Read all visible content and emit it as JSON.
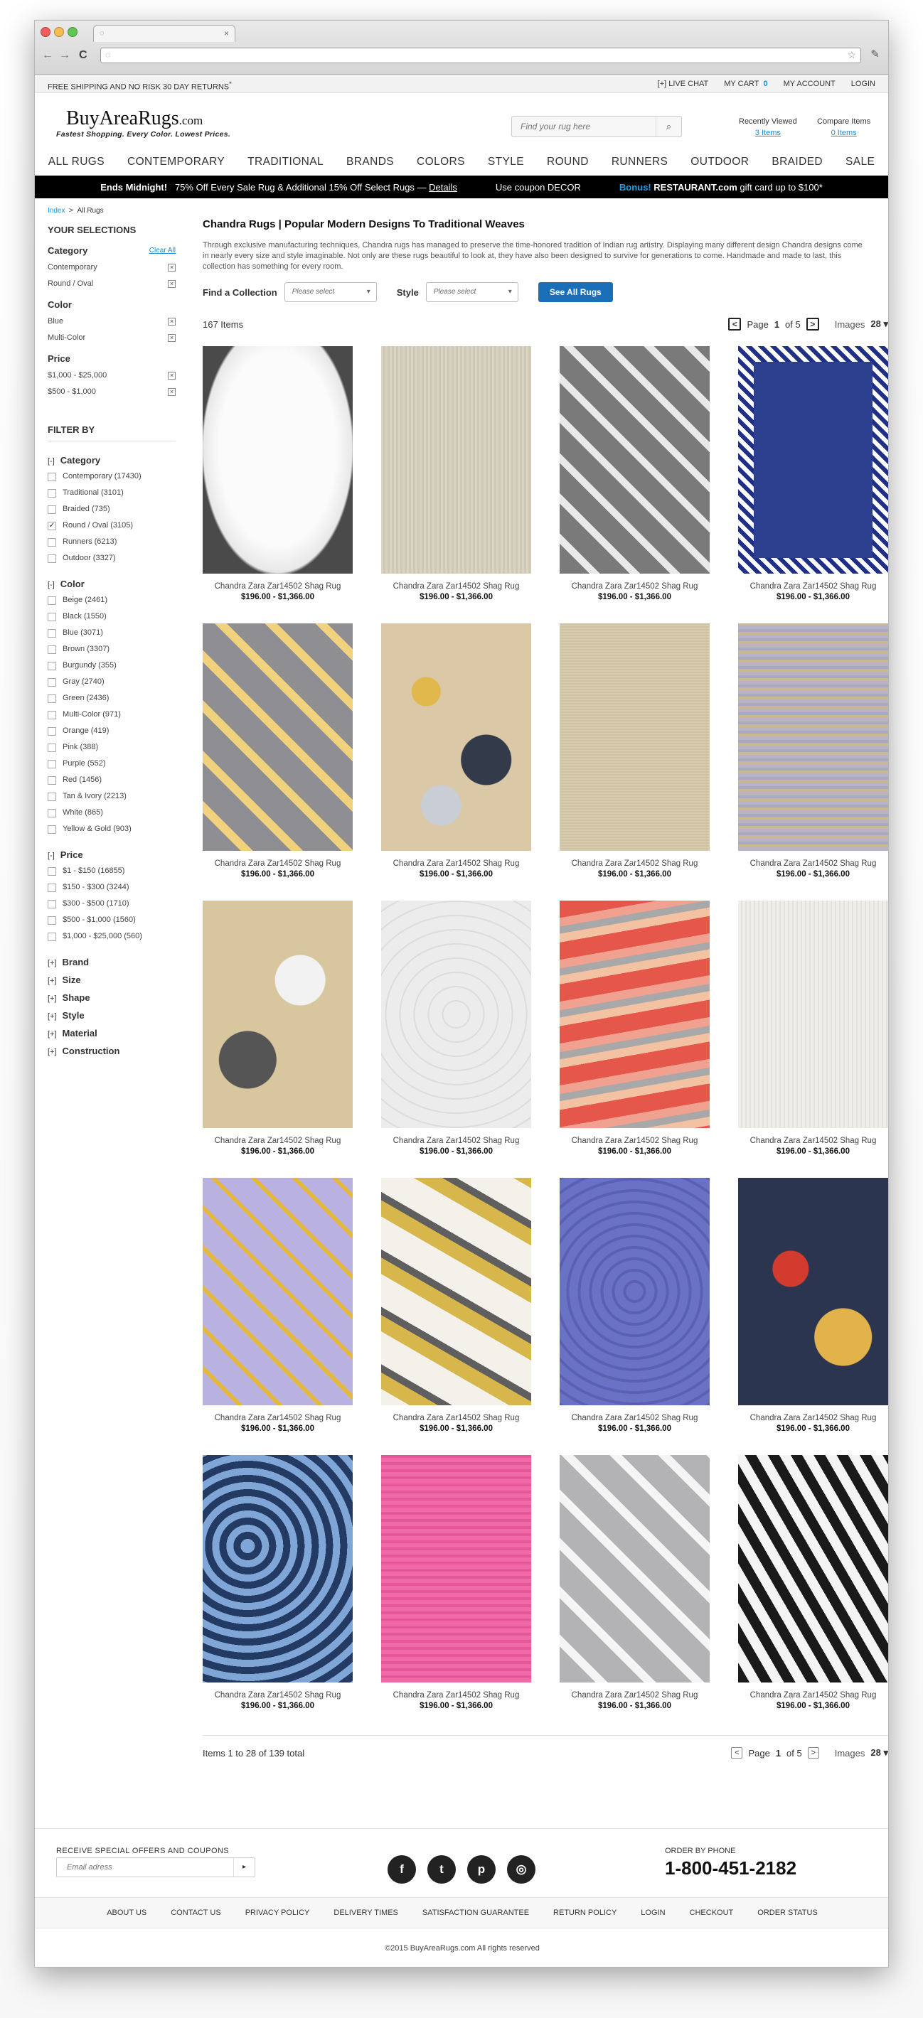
{
  "browser": {
    "colors": {
      "close": "#ee5f5b",
      "min": "#f5bd4f",
      "max": "#61c454"
    },
    "tab_icon": "globe-icon",
    "tab_close": "×",
    "back": "←",
    "forward": "→",
    "reload": "C",
    "url": "",
    "star": "☆",
    "wrench": "🔧"
  },
  "topbar": {
    "shipping": "FREE SHIPPING AND NO RISK 30 DAY RETURNS",
    "shipping_mark": "*",
    "live_chat": "[+] LIVE CHAT",
    "my_cart": "MY CART",
    "cart_count": "0",
    "my_account": "MY ACCOUNT",
    "login": "LOGIN"
  },
  "header": {
    "logo": "BuyAreaRugs",
    "logo_tld": ".com",
    "tagline": "Fastest Shopping. Every Color. Lowest Prices.",
    "search_placeholder": "Find your rug here",
    "search_icon": "search-icon",
    "recently_viewed_label": "Recently Viewed",
    "recently_viewed_count": "3 Items",
    "compare_label": "Compare Items",
    "compare_count": "0 Items"
  },
  "mainnav": [
    "ALL RUGS",
    "CONTEMPORARY",
    "TRADITIONAL",
    "BRANDS",
    "COLORS",
    "STYLE",
    "ROUND",
    "RUNNERS",
    "OUTDOOR",
    "BRAIDED",
    "SALE"
  ],
  "promo": {
    "ends": "Ends Midnight!",
    "offer": "75% Off Every Sale Rug & Additional 15% Off Select Rugs",
    "dash": "—",
    "details": "Details",
    "coupon": "Use coupon DECOR",
    "bonus": "Bonus!",
    "restaurant": "RESTAURANT.com",
    "gift": "gift card up to $100*"
  },
  "breadcrumb": {
    "index": "Index",
    "sep": ">",
    "current": "All Rugs"
  },
  "selections": {
    "title": "YOUR SELECTIONS",
    "clear_all": "Clear All",
    "groups": [
      {
        "name": "Category",
        "items": [
          "Contemporary",
          "Round / Oval"
        ]
      },
      {
        "name": "Color",
        "items": [
          "Blue",
          "Multi-Color"
        ]
      },
      {
        "name": "Price",
        "items": [
          "$1,000 - $25,000",
          "$500 - $1,000"
        ]
      }
    ],
    "remove_glyph": "×"
  },
  "filter": {
    "title": "FILTER BY",
    "groups": [
      {
        "name": "Category",
        "toggle": "[-]",
        "items": [
          {
            "label": "Contemporary (17430)",
            "checked": false
          },
          {
            "label": "Traditional (3101)",
            "checked": false
          },
          {
            "label": "Braided (735)",
            "checked": false
          },
          {
            "label": "Round / Oval (3105)",
            "checked": true
          },
          {
            "label": "Runners (6213)",
            "checked": false
          },
          {
            "label": "Outdoor (3327)",
            "checked": false
          }
        ]
      },
      {
        "name": "Color",
        "toggle": "[-]",
        "items": [
          {
            "label": "Beige (2461)",
            "checked": false
          },
          {
            "label": "Black (1550)",
            "checked": false
          },
          {
            "label": "Blue (3071)",
            "checked": false
          },
          {
            "label": "Brown (3307)",
            "checked": false
          },
          {
            "label": "Burgundy (355)",
            "checked": false
          },
          {
            "label": "Gray (2740)",
            "checked": false
          },
          {
            "label": "Green (2436)",
            "checked": false
          },
          {
            "label": "Multi-Color (971)",
            "checked": false
          },
          {
            "label": "Orange (419)",
            "checked": false
          },
          {
            "label": "Pink (388)",
            "checked": false
          },
          {
            "label": "Purple (552)",
            "checked": false
          },
          {
            "label": "Red (1456)",
            "checked": false
          },
          {
            "label": "Tan & Ivory (2213)",
            "checked": false
          },
          {
            "label": "White (865)",
            "checked": false
          },
          {
            "label": "Yellow & Gold (903)",
            "checked": false
          }
        ]
      },
      {
        "name": "Price",
        "toggle": "[-]",
        "items": [
          {
            "label": "$1 - $150 (16855)",
            "checked": false
          },
          {
            "label": "$150 - $300 (3244)",
            "checked": false
          },
          {
            "label": "$300 - $500 (1710)",
            "checked": false
          },
          {
            "label": "$500 - $1,000 (1560)",
            "checked": false
          },
          {
            "label": "$1,000 - $25,000 (560)",
            "checked": false
          }
        ]
      }
    ],
    "collapsed": [
      "Brand",
      "Size",
      "Shape",
      "Style",
      "Material",
      "Construction"
    ],
    "collapsed_toggle": "[+]",
    "check_glyph": "✓"
  },
  "main": {
    "title": "Chandra Rugs | Popular Modern Designs To Traditional Weaves",
    "description": "Through exclusive manufacturing techniques, Chandra rugs has managed to preserve the time-honored tradition of Indian rug artistry. Displaying many different design Chandra designs come in nearly every size and style imaginable. Not only are these rugs beautiful to look at, they have also been designed to survive for generations to come. Handmade and made to last, this collection has something for every room.",
    "find_collection": "Find a Collection",
    "collection_placeholder": "Please select",
    "style_label": "Style",
    "style_placeholder": "Please select",
    "see_all": "See All Rugs",
    "item_count": "167 Items",
    "page_word": "Page",
    "page_current": "1",
    "page_of": "of 5",
    "images_label": "Images",
    "images_value": "28",
    "caret": "⌄",
    "prev": "<",
    "next": ">",
    "bottom_count": "Items 1 to 28 of 139 total"
  },
  "products": [
    {
      "name": "Chandra Zara Zar14502 Shag Rug",
      "price": "$196.00 - $1,366.00",
      "pattern": "shag-white"
    },
    {
      "name": "Chandra Zara Zar14502 Shag Rug",
      "price": "$196.00 - $1,366.00",
      "pattern": "plain-beige"
    },
    {
      "name": "Chandra Zara Zar14502 Shag Rug",
      "price": "$196.00 - $1,366.00",
      "pattern": "shag-gray-trellis"
    },
    {
      "name": "Chandra Zara Zar14502 Shag Rug",
      "price": "$196.00 - $1,366.00",
      "pattern": "navy-border"
    },
    {
      "name": "Chandra Zara Zar14502 Shag Rug",
      "price": "$196.00 - $1,366.00",
      "pattern": "gray-yellow-trellis"
    },
    {
      "name": "Chandra Zara Zar14502 Shag Rug",
      "price": "$196.00 - $1,366.00",
      "pattern": "floral-multi"
    },
    {
      "name": "Chandra Zara Zar14502 Shag Rug",
      "price": "$196.00 - $1,366.00",
      "pattern": "plain-sisal"
    },
    {
      "name": "Chandra Zara Zar14502 Shag Rug",
      "price": "$196.00 - $1,366.00",
      "pattern": "distressed"
    },
    {
      "name": "Chandra Zara Zar14502 Shag Rug",
      "price": "$196.00 - $1,366.00",
      "pattern": "gold-gray"
    },
    {
      "name": "Chandra Zara Zar14502 Shag Rug",
      "price": "$196.00 - $1,366.00",
      "pattern": "white-carved"
    },
    {
      "name": "Chandra Zara Zar14502 Shag Rug",
      "price": "$196.00 - $1,366.00",
      "pattern": "ikat-red"
    },
    {
      "name": "Chandra Zara Zar14502 Shag Rug",
      "price": "$196.00 - $1,366.00",
      "pattern": "knit-ivory"
    },
    {
      "name": "Chandra Zara Zar14502 Shag Rug",
      "price": "$196.00 - $1,366.00",
      "pattern": "pastel-trellis"
    },
    {
      "name": "Chandra Zara Zar14502 Shag Rug",
      "price": "$196.00 - $1,366.00",
      "pattern": "ikat-gold"
    },
    {
      "name": "Chandra Zara Zar14502 Shag Rug",
      "price": "$196.00 - $1,366.00",
      "pattern": "periwinkle"
    },
    {
      "name": "Chandra Zara Zar14502 Shag Rug",
      "price": "$196.00 - $1,366.00",
      "pattern": "red-floral"
    },
    {
      "name": "Chandra Zara Zar14502 Shag Rug",
      "price": "$196.00 - $1,366.00",
      "pattern": "blue-damask"
    },
    {
      "name": "Chandra Zara Zar14502 Shag Rug",
      "price": "$196.00 - $1,366.00",
      "pattern": "hot-pink"
    },
    {
      "name": "Chandra Zara Zar14502 Shag Rug",
      "price": "$196.00 - $1,366.00",
      "pattern": "gray-trellis"
    },
    {
      "name": "Chandra Zara Zar14502 Shag Rug",
      "price": "$196.00 - $1,366.00",
      "pattern": "chevron-black"
    }
  ],
  "footer": {
    "newsletter_label": "RECEIVE SPECIAL OFFERS AND COUPONS",
    "email_placeholder": "Email adress",
    "submit_glyph": "▸",
    "social": [
      {
        "icon": "facebook-icon",
        "glyph": "f"
      },
      {
        "icon": "twitter-icon",
        "glyph": "t"
      },
      {
        "icon": "pinterest-icon",
        "glyph": "p"
      },
      {
        "icon": "instagram-icon",
        "glyph": "◎"
      }
    ],
    "phone_label": "ORDER BY PHONE",
    "phone": "1-800-451-2182",
    "links": [
      "ABOUT US",
      "CONTACT US",
      "PRIVACY POLICY",
      "DELIVERY TIMES",
      "SATISFACTION GUARANTEE",
      "RETURN POLICY",
      "LOGIN",
      "CHECKOUT",
      "ORDER STATUS"
    ],
    "copyright": "©2015 BuyAreaRugs.com All rights reserved"
  }
}
